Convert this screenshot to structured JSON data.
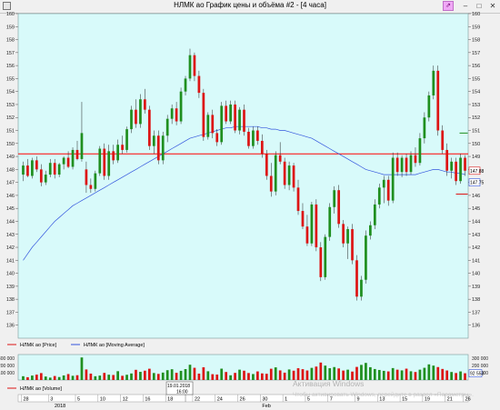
{
  "window": {
    "title": "НЛМК ао График цены и объёма #2 - [4 часа]",
    "pin_label": "⇗",
    "min_label": "–",
    "max_label": "□",
    "close_label": "✕"
  },
  "chart_data": {
    "type": "candlestick",
    "series_names": [
      "НЛМК ао [Price]",
      "НЛМК ао [Moving Average]",
      "НЛМК ао [Volume]"
    ],
    "price_ylim": [
      135,
      160
    ],
    "price_ticks": [
      "160",
      "159",
      "158",
      "157",
      "156",
      "155",
      "154",
      "153",
      "152",
      "151",
      "150",
      "149",
      "148",
      "147",
      "146",
      "145",
      "144",
      "143",
      "142",
      "141",
      "140",
      "139",
      "138",
      "137",
      "136"
    ],
    "horizontal_level": 149.2,
    "last_price_label": "147.88",
    "ma_price_label": "147.75",
    "volume_ticks": [
      "300 000",
      "200 000",
      "100 000"
    ],
    "volume_last_label": "92 553",
    "volume_ylim": [
      0,
      350000
    ],
    "x_tick_labels": [
      "28",
      "3",
      "5",
      "10",
      "12",
      "16",
      "18",
      "22",
      "24",
      "26",
      "30",
      "1",
      "5",
      "7",
      "9",
      "13",
      "15",
      "19",
      "21",
      "26"
    ],
    "x_year_label": "2018",
    "x_month_label": "Feb",
    "tooltip_date": "19.01.2018",
    "tooltip_time": "16:00",
    "watermark_line1": "Активация Windows",
    "watermark_line2": "Чтобы активировать Windows, перейдите в раздел «Параметры».",
    "colors": {
      "chart_bg": "#d8fafa",
      "up": "#1f8f1f",
      "down": "#dd1515",
      "ma": "#3355dd",
      "level": "#ff0000"
    },
    "candles": [
      {
        "o": 147.6,
        "h": 148.6,
        "l": 147.1,
        "c": 148.3
      },
      {
        "o": 148.3,
        "h": 148.8,
        "l": 147.4,
        "c": 147.5
      },
      {
        "o": 147.5,
        "h": 148.9,
        "l": 147.3,
        "c": 148.7
      },
      {
        "o": 148.7,
        "h": 149.0,
        "l": 147.8,
        "c": 148.0
      },
      {
        "o": 148.0,
        "h": 148.4,
        "l": 146.7,
        "c": 147.0
      },
      {
        "o": 147.0,
        "h": 147.9,
        "l": 146.8,
        "c": 147.6
      },
      {
        "o": 147.6,
        "h": 148.8,
        "l": 147.4,
        "c": 148.5
      },
      {
        "o": 148.5,
        "h": 148.8,
        "l": 147.3,
        "c": 147.6
      },
      {
        "o": 147.6,
        "h": 148.5,
        "l": 147.4,
        "c": 148.4
      },
      {
        "o": 148.4,
        "h": 149.0,
        "l": 148.0,
        "c": 148.9
      },
      {
        "o": 148.9,
        "h": 149.4,
        "l": 148.1,
        "c": 148.2
      },
      {
        "o": 148.2,
        "h": 149.7,
        "l": 148.0,
        "c": 149.5
      },
      {
        "o": 149.5,
        "h": 150.2,
        "l": 148.7,
        "c": 148.8
      },
      {
        "o": 148.8,
        "h": 153.2,
        "l": 148.6,
        "c": 150.8
      },
      {
        "o": 148.0,
        "h": 148.6,
        "l": 146.2,
        "c": 146.8
      },
      {
        "o": 146.8,
        "h": 147.3,
        "l": 146.2,
        "c": 146.5
      },
      {
        "o": 146.5,
        "h": 147.9,
        "l": 146.3,
        "c": 147.7
      },
      {
        "o": 147.7,
        "h": 149.8,
        "l": 147.5,
        "c": 149.6
      },
      {
        "o": 149.6,
        "h": 150.0,
        "l": 147.2,
        "c": 147.5
      },
      {
        "o": 147.5,
        "h": 149.9,
        "l": 147.2,
        "c": 149.4
      },
      {
        "o": 149.4,
        "h": 149.9,
        "l": 148.4,
        "c": 148.7
      },
      {
        "o": 148.7,
        "h": 150.3,
        "l": 148.5,
        "c": 149.9
      },
      {
        "o": 149.9,
        "h": 150.6,
        "l": 149.2,
        "c": 149.5
      },
      {
        "o": 149.5,
        "h": 151.3,
        "l": 149.3,
        "c": 151.1
      },
      {
        "o": 151.1,
        "h": 152.9,
        "l": 150.8,
        "c": 152.6
      },
      {
        "o": 152.6,
        "h": 153.4,
        "l": 151.2,
        "c": 151.5
      },
      {
        "o": 151.5,
        "h": 153.8,
        "l": 151.2,
        "c": 153.4
      },
      {
        "o": 153.4,
        "h": 154.2,
        "l": 152.3,
        "c": 152.6
      },
      {
        "o": 152.6,
        "h": 152.9,
        "l": 149.5,
        "c": 149.8
      },
      {
        "o": 149.8,
        "h": 151.0,
        "l": 149.2,
        "c": 150.6
      },
      {
        "o": 150.6,
        "h": 151.0,
        "l": 148.4,
        "c": 148.7
      },
      {
        "o": 148.7,
        "h": 150.9,
        "l": 148.4,
        "c": 150.6
      },
      {
        "o": 150.6,
        "h": 152.2,
        "l": 150.1,
        "c": 151.9
      },
      {
        "o": 151.9,
        "h": 153.0,
        "l": 151.5,
        "c": 152.7
      },
      {
        "o": 152.7,
        "h": 153.2,
        "l": 151.4,
        "c": 151.7
      },
      {
        "o": 151.7,
        "h": 154.3,
        "l": 151.5,
        "c": 154.0
      },
      {
        "o": 154.0,
        "h": 155.2,
        "l": 153.7,
        "c": 155.0
      },
      {
        "o": 155.0,
        "h": 157.3,
        "l": 154.8,
        "c": 156.8
      },
      {
        "o": 156.8,
        "h": 157.0,
        "l": 154.8,
        "c": 155.2
      },
      {
        "o": 155.2,
        "h": 155.6,
        "l": 153.5,
        "c": 153.9
      },
      {
        "o": 153.9,
        "h": 154.2,
        "l": 150.2,
        "c": 150.5
      },
      {
        "o": 150.5,
        "h": 152.4,
        "l": 150.3,
        "c": 152.2
      },
      {
        "o": 152.2,
        "h": 152.6,
        "l": 150.4,
        "c": 150.8
      },
      {
        "o": 150.8,
        "h": 151.1,
        "l": 149.8,
        "c": 150.1
      },
      {
        "o": 150.1,
        "h": 153.2,
        "l": 149.9,
        "c": 152.9
      },
      {
        "o": 152.9,
        "h": 153.3,
        "l": 151.5,
        "c": 151.7
      },
      {
        "o": 151.7,
        "h": 153.3,
        "l": 151.5,
        "c": 153.0
      },
      {
        "o": 153.0,
        "h": 153.3,
        "l": 150.8,
        "c": 151.0
      },
      {
        "o": 151.0,
        "h": 152.8,
        "l": 150.7,
        "c": 152.6
      },
      {
        "o": 152.6,
        "h": 153.0,
        "l": 150.6,
        "c": 150.9
      },
      {
        "o": 150.9,
        "h": 151.2,
        "l": 149.6,
        "c": 149.8
      },
      {
        "o": 149.8,
        "h": 151.3,
        "l": 149.6,
        "c": 151.0
      },
      {
        "o": 151.0,
        "h": 151.3,
        "l": 149.9,
        "c": 150.2
      },
      {
        "o": 150.2,
        "h": 150.7,
        "l": 148.9,
        "c": 149.2
      },
      {
        "o": 149.2,
        "h": 149.5,
        "l": 147.2,
        "c": 147.5
      },
      {
        "o": 147.5,
        "h": 148.5,
        "l": 145.9,
        "c": 146.3
      },
      {
        "o": 146.3,
        "h": 149.4,
        "l": 146.0,
        "c": 149.1
      },
      {
        "o": 149.1,
        "h": 150.1,
        "l": 148.4,
        "c": 148.6
      },
      {
        "o": 148.6,
        "h": 148.9,
        "l": 146.5,
        "c": 146.8
      },
      {
        "o": 146.8,
        "h": 148.6,
        "l": 146.4,
        "c": 148.3
      },
      {
        "o": 148.3,
        "h": 148.5,
        "l": 146.3,
        "c": 146.6
      },
      {
        "o": 146.6,
        "h": 147.2,
        "l": 144.5,
        "c": 144.8
      },
      {
        "o": 144.8,
        "h": 145.4,
        "l": 143.4,
        "c": 143.6
      },
      {
        "o": 143.6,
        "h": 144.5,
        "l": 142.1,
        "c": 142.3
      },
      {
        "o": 142.3,
        "h": 145.5,
        "l": 142.1,
        "c": 145.3
      },
      {
        "o": 145.3,
        "h": 145.7,
        "l": 141.7,
        "c": 142.0
      },
      {
        "o": 142.0,
        "h": 142.4,
        "l": 139.4,
        "c": 139.7
      },
      {
        "o": 139.7,
        "h": 143.0,
        "l": 139.5,
        "c": 142.8
      },
      {
        "o": 142.8,
        "h": 145.4,
        "l": 142.5,
        "c": 145.1
      },
      {
        "o": 145.1,
        "h": 146.7,
        "l": 144.6,
        "c": 146.4
      },
      {
        "o": 146.4,
        "h": 146.8,
        "l": 143.5,
        "c": 143.8
      },
      {
        "o": 143.8,
        "h": 144.1,
        "l": 142.0,
        "c": 142.3
      },
      {
        "o": 142.3,
        "h": 143.6,
        "l": 141.1,
        "c": 143.4
      },
      {
        "o": 143.4,
        "h": 143.8,
        "l": 140.7,
        "c": 141.0
      },
      {
        "o": 141.0,
        "h": 141.4,
        "l": 137.9,
        "c": 138.2
      },
      {
        "o": 138.2,
        "h": 139.8,
        "l": 137.9,
        "c": 139.5
      },
      {
        "o": 139.5,
        "h": 143.3,
        "l": 139.2,
        "c": 142.9
      },
      {
        "o": 142.9,
        "h": 144.0,
        "l": 142.6,
        "c": 143.7
      },
      {
        "o": 143.7,
        "h": 145.7,
        "l": 143.4,
        "c": 145.3
      },
      {
        "o": 145.3,
        "h": 146.9,
        "l": 145.0,
        "c": 146.6
      },
      {
        "o": 146.6,
        "h": 147.5,
        "l": 145.4,
        "c": 147.2
      },
      {
        "o": 147.2,
        "h": 147.5,
        "l": 145.2,
        "c": 145.6
      },
      {
        "o": 145.6,
        "h": 149.3,
        "l": 145.4,
        "c": 148.9
      },
      {
        "o": 148.9,
        "h": 149.3,
        "l": 147.5,
        "c": 147.8
      },
      {
        "o": 147.8,
        "h": 149.1,
        "l": 147.4,
        "c": 148.9
      },
      {
        "o": 148.9,
        "h": 149.2,
        "l": 147.5,
        "c": 147.8
      },
      {
        "o": 147.8,
        "h": 149.4,
        "l": 147.6,
        "c": 149.1
      },
      {
        "o": 149.1,
        "h": 149.7,
        "l": 148.2,
        "c": 148.5
      },
      {
        "o": 148.5,
        "h": 150.8,
        "l": 148.3,
        "c": 150.4
      },
      {
        "o": 150.4,
        "h": 152.4,
        "l": 150.0,
        "c": 152.0
      },
      {
        "o": 152.0,
        "h": 154.0,
        "l": 151.7,
        "c": 153.7
      },
      {
        "o": 153.7,
        "h": 156.0,
        "l": 153.4,
        "c": 155.6
      },
      {
        "o": 155.6,
        "h": 156.0,
        "l": 150.6,
        "c": 151.0
      },
      {
        "o": 151.0,
        "h": 151.4,
        "l": 149.2,
        "c": 149.5
      },
      {
        "o": 149.5,
        "h": 150.0,
        "l": 147.5,
        "c": 147.9
      },
      {
        "o": 147.9,
        "h": 148.9,
        "l": 147.3,
        "c": 148.6
      },
      {
        "o": 148.6,
        "h": 148.9,
        "l": 146.8,
        "c": 147.1
      },
      {
        "o": 147.1,
        "h": 149.2,
        "l": 146.9,
        "c": 148.9
      },
      {
        "o": 148.9,
        "h": 149.1,
        "l": 147.5,
        "c": 147.9
      }
    ],
    "ma": [
      141.0,
      141.5,
      142.0,
      142.4,
      142.8,
      143.2,
      143.6,
      144.0,
      144.3,
      144.6,
      144.9,
      145.2,
      145.4,
      145.6,
      145.8,
      146.0,
      146.2,
      146.4,
      146.6,
      146.8,
      147.0,
      147.2,
      147.4,
      147.6,
      147.8,
      148.0,
      148.2,
      148.4,
      148.6,
      148.8,
      149.0,
      149.2,
      149.4,
      149.6,
      149.8,
      150.0,
      150.2,
      150.4,
      150.5,
      150.6,
      150.7,
      150.8,
      150.9,
      151.0,
      151.1,
      151.2,
      151.2,
      151.3,
      151.3,
      151.3,
      151.3,
      151.3,
      151.3,
      151.2,
      151.2,
      151.1,
      151.1,
      151.0,
      151.0,
      150.9,
      150.8,
      150.7,
      150.6,
      150.5,
      150.4,
      150.2,
      150.0,
      149.8,
      149.6,
      149.4,
      149.2,
      149.0,
      148.8,
      148.6,
      148.4,
      148.2,
      148.0,
      147.9,
      147.8,
      147.7,
      147.6,
      147.6,
      147.6,
      147.6,
      147.6,
      147.6,
      147.6,
      147.6,
      147.7,
      147.8,
      147.9,
      148.0,
      148.0,
      147.9,
      147.8,
      147.8,
      147.7,
      147.7,
      147.6
    ],
    "volume": [
      52,
      38,
      61,
      74,
      95,
      48,
      33,
      55,
      41,
      63,
      82,
      58,
      66,
      310,
      145,
      88,
      52,
      61,
      98,
      73,
      69,
      121,
      58,
      72,
      90,
      140,
      112,
      128,
      155,
      96,
      84,
      102,
      135,
      148,
      99,
      126,
      150,
      210,
      168,
      88,
      175,
      120,
      80,
      75,
      156,
      110,
      65,
      98,
      142,
      128,
      96,
      82,
      118,
      91,
      86,
      155,
      174,
      132,
      101,
      145,
      128,
      162,
      149,
      131,
      167,
      185,
      240,
      198,
      162,
      178,
      159,
      130,
      142,
      116,
      180,
      208,
      235,
      176,
      151,
      138,
      126,
      118,
      164,
      142,
      132,
      156,
      120,
      110,
      142,
      168,
      215,
      198,
      178,
      152,
      131,
      110,
      96,
      118,
      93
    ]
  }
}
